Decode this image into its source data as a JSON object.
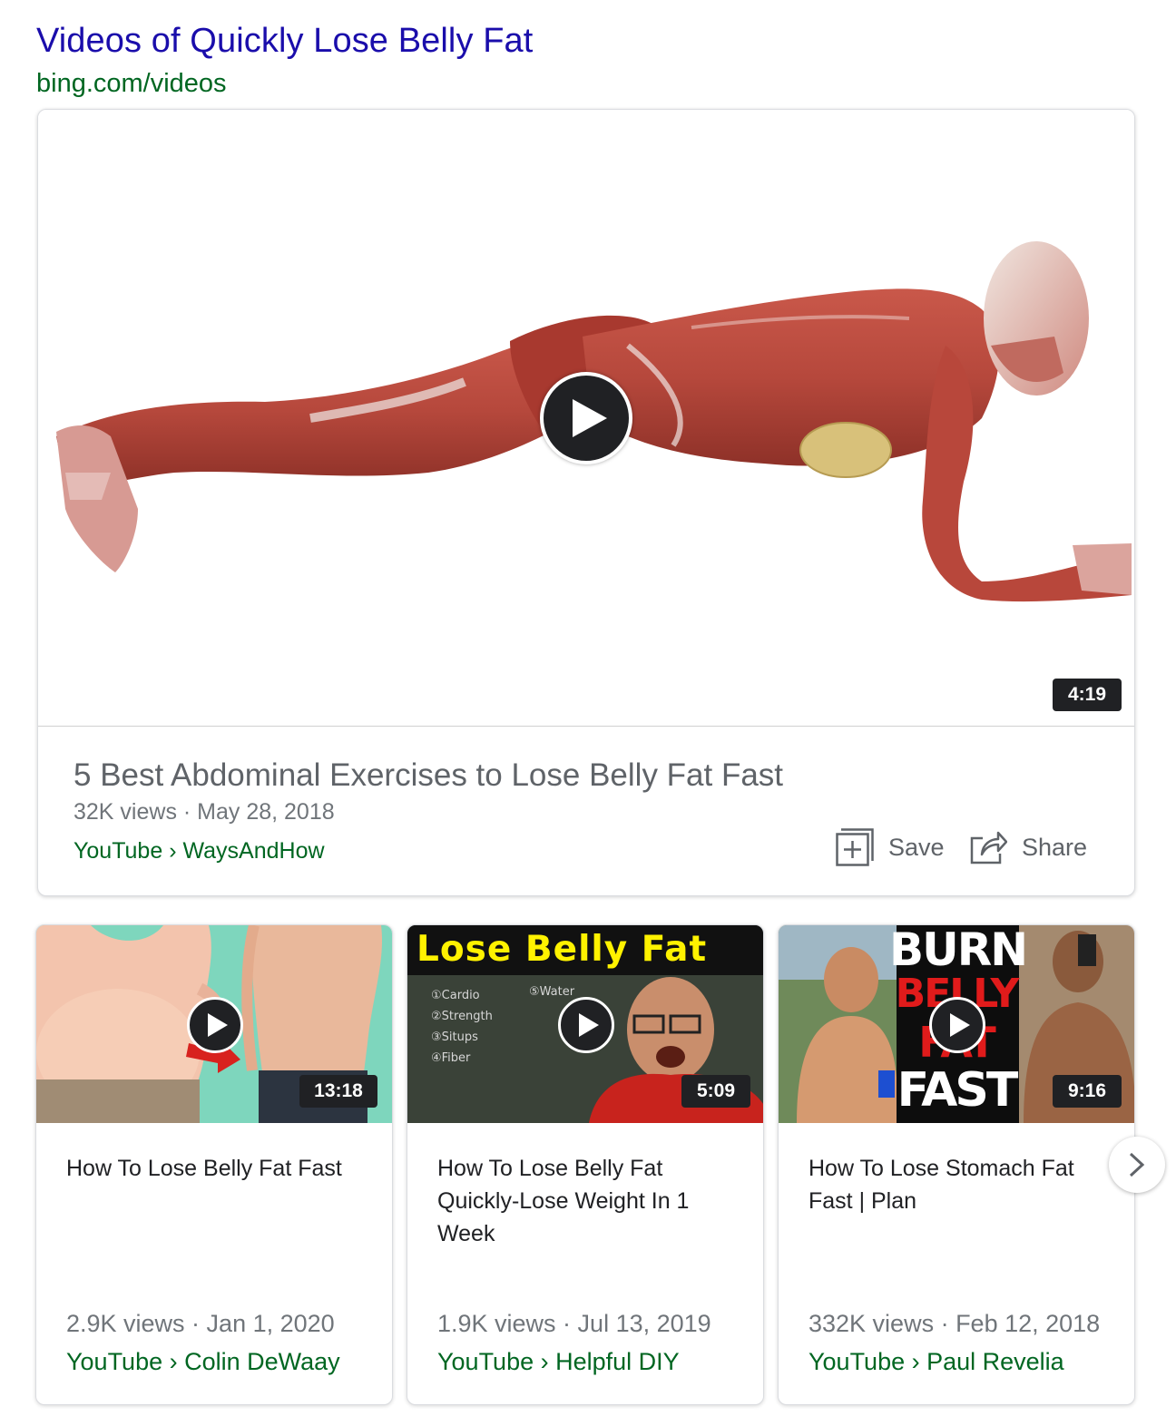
{
  "header": {
    "title": "Videos of Quickly Lose Belly Fat",
    "url": "bing.com/videos"
  },
  "main_video": {
    "thumbnail_icon": "muscle-anatomy-plank-figure",
    "duration": "4:19",
    "title": "5 Best Abdominal Exercises to Lose Belly Fat Fast",
    "meta": "32K views · May 28, 2018",
    "source": "YouTube › WaysAndHow",
    "save_label": "Save",
    "share_label": "Share"
  },
  "videos": [
    {
      "duration": "13:18",
      "title": "How To Lose Belly Fat Fast",
      "meta": "2.9K views · Jan 1, 2020",
      "source": "YouTube › Colin DeWaay"
    },
    {
      "thumb_banner": "Lose Belly Fat",
      "chalkboard_lines": [
        "①Cardio",
        "②Strength",
        "③Situps",
        "④Fiber",
        "⑤Water"
      ],
      "duration": "5:09",
      "title": "How To Lose Belly Fat Quickly-Lose Weight In 1 Week",
      "meta": "1.9K views · Jul 13, 2019",
      "source": "YouTube › Helpful DIY"
    },
    {
      "thumb_words": [
        "BURN",
        "BELLY",
        "FAT",
        "FAST"
      ],
      "duration": "9:16",
      "title": "How To Lose Stomach Fat Fast | Plan",
      "meta": "332K views · Feb 12, 2018",
      "source": "YouTube › Paul Revelia"
    }
  ],
  "colors": {
    "link_blue": "#1a0dab",
    "url_green": "#006621",
    "meta_gray": "#70757a",
    "badge_dark": "#202124"
  }
}
